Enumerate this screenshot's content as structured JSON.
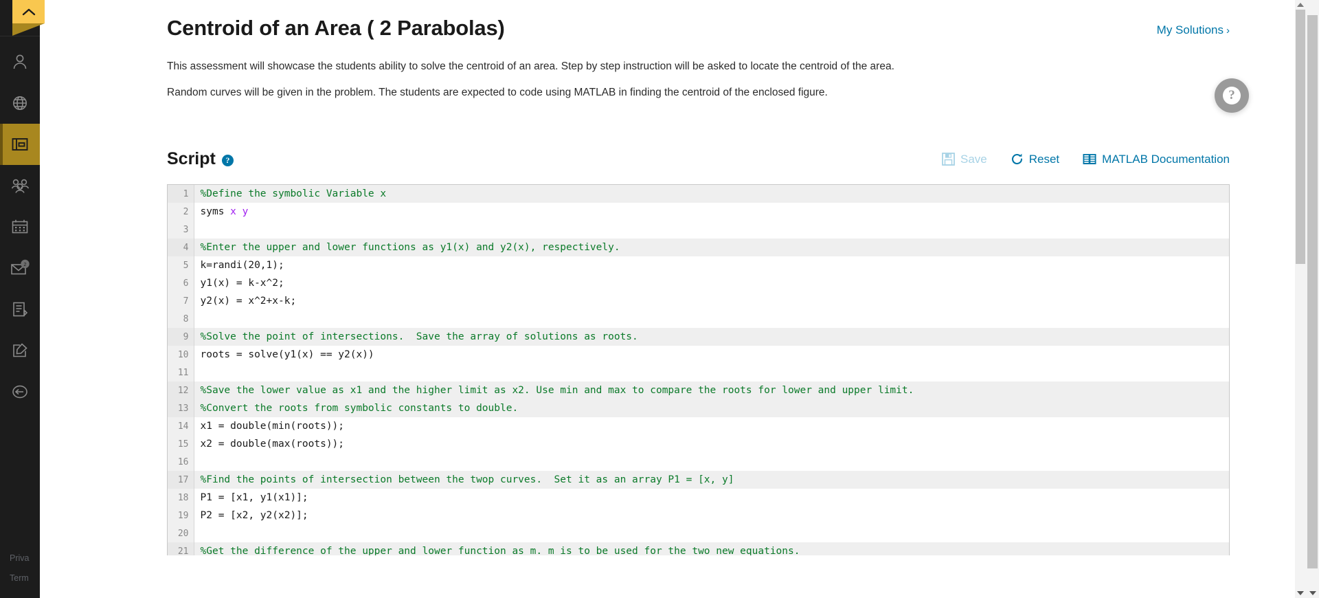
{
  "sidebar": {
    "collapse_toggle": "collapse-panel",
    "items": [
      {
        "name": "sidebar-item-profile",
        "icon": "person-icon"
      },
      {
        "name": "sidebar-item-language",
        "icon": "globe-icon"
      },
      {
        "name": "sidebar-item-courses",
        "icon": "course-book-icon",
        "active": true
      },
      {
        "name": "sidebar-item-groups",
        "icon": "people-icon"
      },
      {
        "name": "sidebar-item-calendar",
        "icon": "calendar-icon"
      },
      {
        "name": "sidebar-item-messages",
        "icon": "envelope-badge-icon"
      },
      {
        "name": "sidebar-item-notes",
        "icon": "document-edit-icon"
      },
      {
        "name": "sidebar-item-compose",
        "icon": "compose-icon"
      },
      {
        "name": "sidebar-item-logout",
        "icon": "logout-arrow-icon"
      }
    ],
    "footer": {
      "privacy": "Priva",
      "terms": "Term"
    }
  },
  "header": {
    "title": "Centroid of an Area ( 2 Parabolas)",
    "my_solutions_label": "My Solutions",
    "my_solutions_chevron": "›"
  },
  "description": {
    "paragraph_1": "This assessment will showcase the students ability to solve the centroid of an area.  Step by step instruction will be asked to locate the centroid of the area.",
    "paragraph_2": "Random curves will be given in the problem.  The students are expected to code using MATLAB in finding the centroid of the enclosed figure."
  },
  "script_section": {
    "title": "Script",
    "help_glyph": "?",
    "actions": {
      "save_label": "Save",
      "save_disabled": true,
      "reset_label": "Reset",
      "docs_label": "MATLAB Documentation"
    }
  },
  "editor": {
    "language": "matlab",
    "lines": [
      {
        "n": "1",
        "type": "comment",
        "text": "%Define the symbolic Variable x"
      },
      {
        "n": "2",
        "type": "code",
        "text": "syms x y",
        "code_prefix": "syms ",
        "var_tokens": "x y"
      },
      {
        "n": "3",
        "type": "code",
        "text": ""
      },
      {
        "n": "4",
        "type": "comment",
        "text": "%Enter the upper and lower functions as y1(x) and y2(x), respectively."
      },
      {
        "n": "5",
        "type": "code",
        "text": "k=randi(20,1);"
      },
      {
        "n": "6",
        "type": "code",
        "text": "y1(x) = k-x^2;"
      },
      {
        "n": "7",
        "type": "code",
        "text": "y2(x) = x^2+x-k;"
      },
      {
        "n": "8",
        "type": "code",
        "text": ""
      },
      {
        "n": "9",
        "type": "comment",
        "text": "%Solve the point of intersections.  Save the array of solutions as roots."
      },
      {
        "n": "10",
        "type": "code",
        "text": "roots = solve(y1(x) == y2(x))"
      },
      {
        "n": "11",
        "type": "code",
        "text": ""
      },
      {
        "n": "12",
        "type": "comment",
        "text": "%Save the lower value as x1 and the higher limit as x2. Use min and max to compare the roots for lower and upper limit."
      },
      {
        "n": "13",
        "type": "comment",
        "text": "%Convert the roots from symbolic constants to double."
      },
      {
        "n": "14",
        "type": "code",
        "text": "x1 = double(min(roots));"
      },
      {
        "n": "15",
        "type": "code",
        "text": "x2 = double(max(roots));"
      },
      {
        "n": "16",
        "type": "code",
        "text": ""
      },
      {
        "n": "17",
        "type": "comment",
        "text": "%Find the points of intersection between the twop curves.  Set it as an array P1 = [x, y]"
      },
      {
        "n": "18",
        "type": "code",
        "text": "P1 = [x1, y1(x1)];"
      },
      {
        "n": "19",
        "type": "code",
        "text": "P2 = [x2, y2(x2)];"
      },
      {
        "n": "20",
        "type": "code",
        "text": ""
      },
      {
        "n": "21",
        "type": "comment",
        "text": "%Get the difference of the upper and lower function as m. m is to be used for the two new equations."
      }
    ]
  },
  "help_fab": {
    "glyph": "?"
  },
  "colors": {
    "accent_link": "#0076a8",
    "sidebar_bg": "#1c1c1c",
    "sidebar_active": "#a8871f",
    "ribbon": "#f9c74f",
    "comment_green": "#0b7a29",
    "var_purple": "#a020f0"
  }
}
